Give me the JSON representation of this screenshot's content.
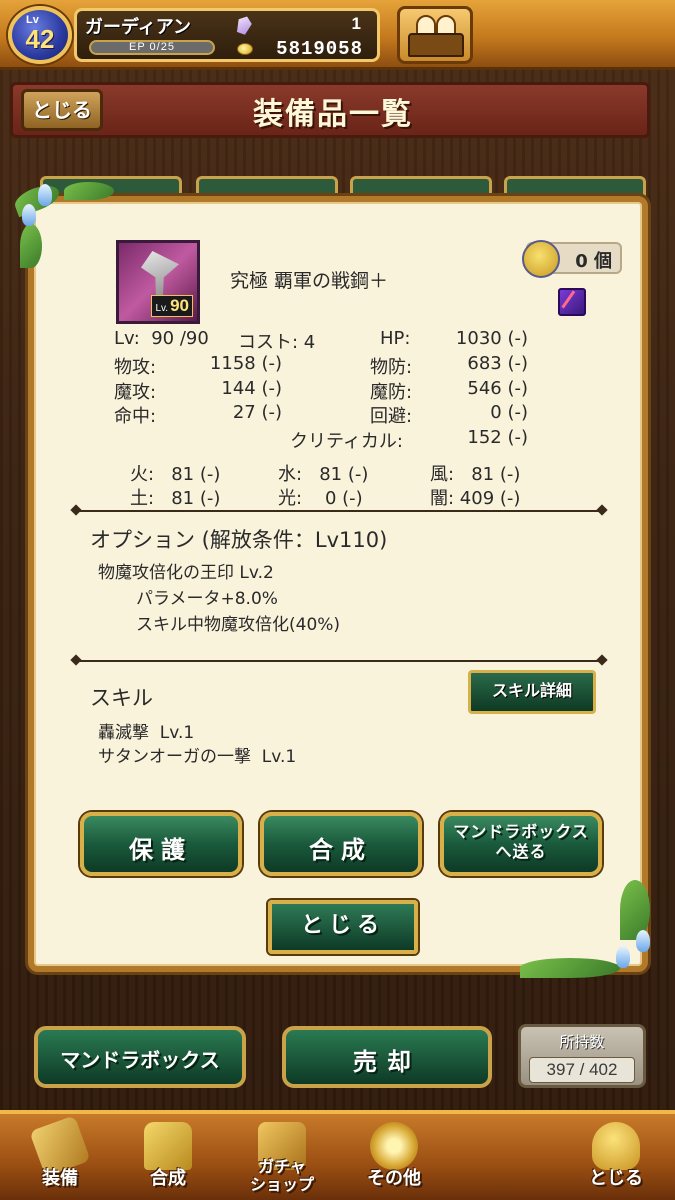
{
  "status": {
    "level_prefix": "Lv",
    "level": "42",
    "player_name": "ガーディアン",
    "ep": "EP 0/25",
    "crystals": "1",
    "gold": "5819058"
  },
  "header": {
    "close_label": "とじる",
    "title": "装備品一覧"
  },
  "item": {
    "name": "究極 覇軍の戦鋼＋",
    "icon_level_prefix": "Lv.",
    "icon_level": "90",
    "count": "0 個",
    "stats": [
      {
        "text": "Lv:  90 /90"
      },
      {
        "text": "コスト: 4"
      },
      {
        "text": "HP:"
      },
      {
        "text": "1030 (-)"
      },
      {
        "text": "物攻:"
      },
      {
        "text": "1158 (-)"
      },
      {
        "text": "物防:"
      },
      {
        "text": "683 (-)"
      },
      {
        "text": "魔攻:"
      },
      {
        "text": "144 (-)"
      },
      {
        "text": "魔防:"
      },
      {
        "text": "546 (-)"
      },
      {
        "text": "命中:"
      },
      {
        "text": "27 (-)"
      },
      {
        "text": "回避:"
      },
      {
        "text": "0 (-)"
      },
      {
        "text": "クリティカル:"
      },
      {
        "text": "152 (-)"
      },
      {
        "text": "火:   81 (-)"
      },
      {
        "text": "水:   81 (-)"
      },
      {
        "text": "風:   81 (-)"
      },
      {
        "text": "土:   81 (-)"
      },
      {
        "text": "光:    0 (-)"
      },
      {
        "text": "闇: 409 (-)"
      }
    ]
  },
  "option": {
    "title": "オプション (解放条件：Lv110)",
    "name": "物魔攻倍化の王印 Lv.2",
    "effect1": "パラメータ+8.0%",
    "effect2": "スキル中物魔攻倍化(40%)"
  },
  "skill": {
    "title": "スキル",
    "detail_button": "スキル詳細",
    "skill1": "轟滅撃  Lv.1",
    "skill2": "サタンオーガの一撃  Lv.1"
  },
  "actions": {
    "protect": "保護",
    "combine": "合成",
    "send_line1": "マンドラボックス",
    "send_line2": "へ送る",
    "close": "とじる"
  },
  "bottom": {
    "mandra_box": "マンドラボックス",
    "sell": "売却",
    "held_label": "所持数",
    "held_value": "397 / 402"
  },
  "nav": {
    "equip": "装備",
    "combine": "合成",
    "gacha_line1": "ガチャ",
    "gacha_line2": "ショップ",
    "other": "その他",
    "close": "とじる"
  },
  "colors": {
    "dialog_bg": "#faf3dc",
    "button_green": "#1a5a3c",
    "button_border_gold": "#d8b04a",
    "header_red": "#6a2418",
    "topbar_orange": "#c57a1d"
  }
}
